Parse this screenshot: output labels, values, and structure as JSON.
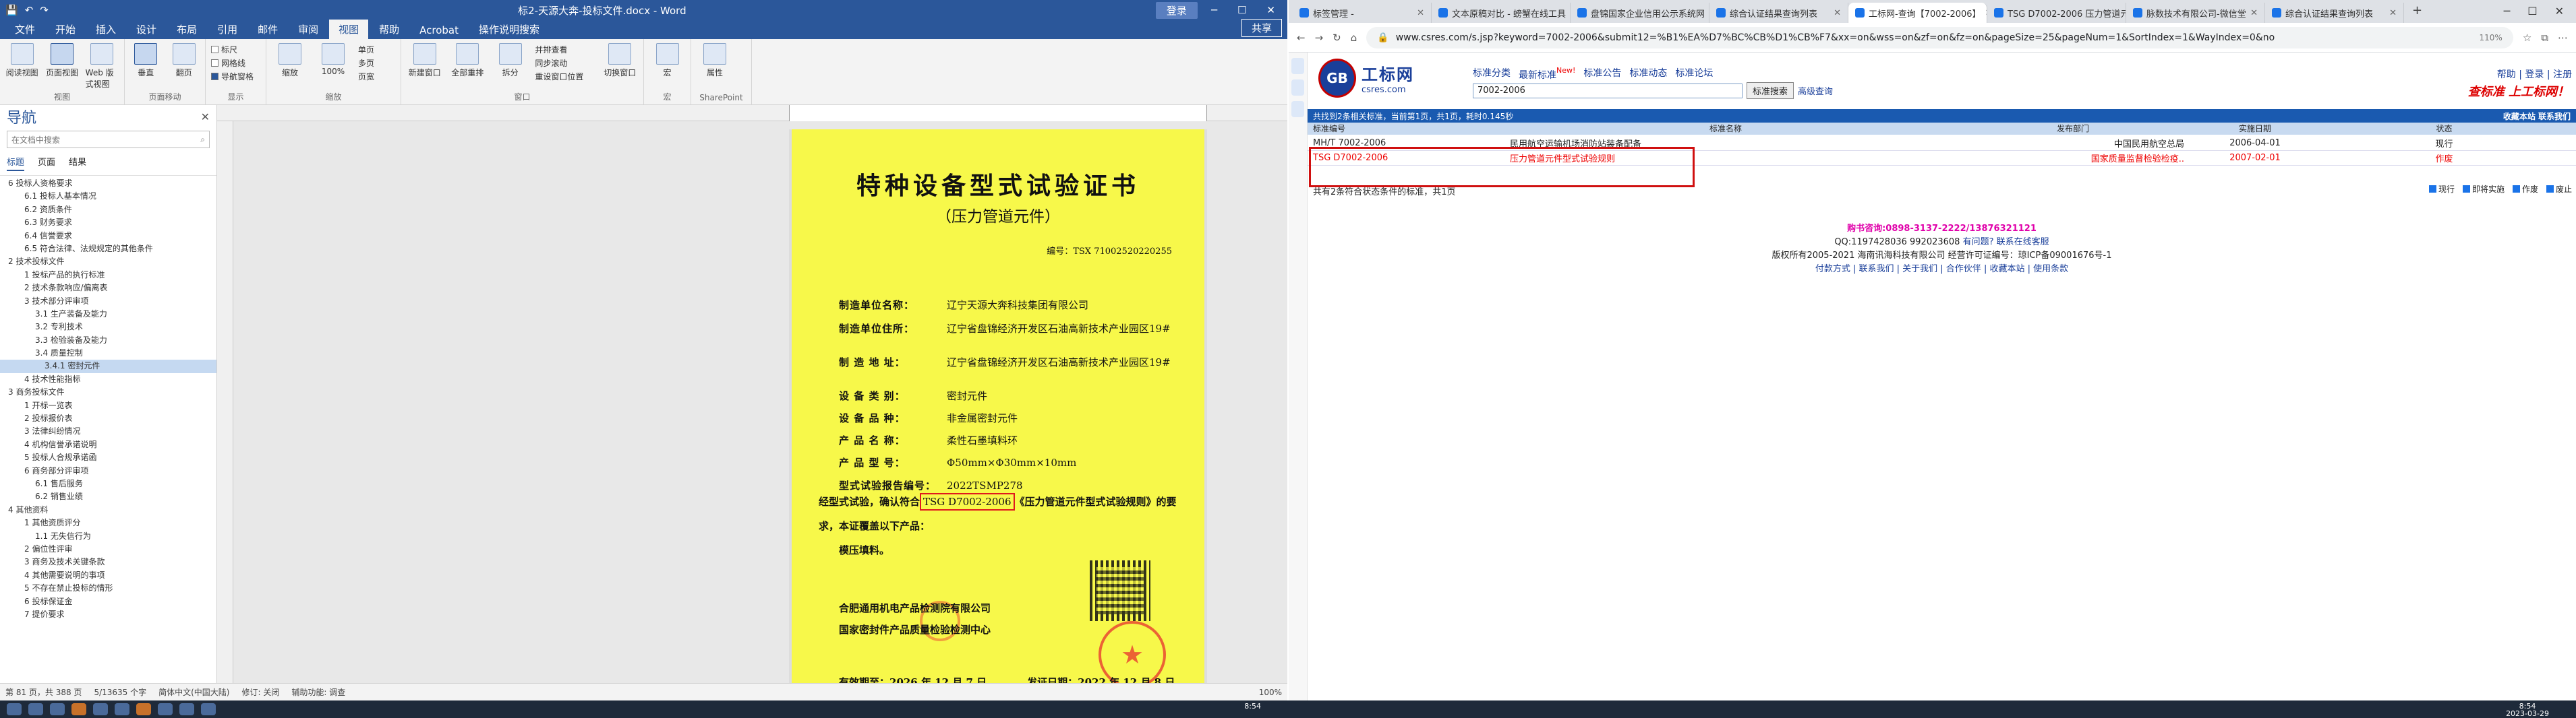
{
  "word": {
    "title": "标2-天源大奔-投标文件.docx - Word",
    "user_button": "登录",
    "share_label": "共享",
    "tabs": [
      "文件",
      "开始",
      "插入",
      "设计",
      "布局",
      "引用",
      "邮件",
      "审阅",
      "视图",
      "帮助",
      "Acrobat",
      "操作说明搜索"
    ],
    "active_tab": "视图",
    "ribbon": {
      "views": [
        "阅读视图",
        "页面视图",
        "Web 版式视图"
      ],
      "views_group": "视图",
      "move": [
        "垂直",
        "翻页"
      ],
      "move_group": "页面移动",
      "show": [
        "标尺",
        "网格线",
        "导航窗格"
      ],
      "show_group": "显示",
      "zoom": [
        "缩放",
        "100%",
        "单页",
        "多页",
        "页宽"
      ],
      "zoom_group": "缩放",
      "window": [
        "新建窗口",
        "全部重排",
        "拆分",
        "并排查看",
        "同步滚动",
        "重设窗口位置",
        "切换窗口"
      ],
      "window_group": "窗口",
      "macro": "宏",
      "macro_group": "宏",
      "sp": "属性",
      "sp_group": "SharePoint"
    },
    "nav": {
      "title": "导航",
      "search_placeholder": "在文档中搜索",
      "tabs": [
        "标题",
        "页面",
        "结果"
      ],
      "items": [
        {
          "t": "6 投标人资格要求",
          "l": "l1"
        },
        {
          "t": "6.1 投标人基本情况",
          "l": "l2"
        },
        {
          "t": "6.2 资质条件",
          "l": "l2"
        },
        {
          "t": "6.3 财务要求",
          "l": "l2"
        },
        {
          "t": "6.4 信誉要求",
          "l": "l2"
        },
        {
          "t": "6.5 符合法律、法规规定的其他条件",
          "l": "l2"
        },
        {
          "t": "2 技术投标文件",
          "l": "l1"
        },
        {
          "t": "1 投标产品的执行标准",
          "l": "l2"
        },
        {
          "t": "2 技术条款响应/偏离表",
          "l": "l2"
        },
        {
          "t": "3 技术部分评审项",
          "l": "l2"
        },
        {
          "t": "3.1 生产装备及能力",
          "l": "l3"
        },
        {
          "t": "3.2 专利技术",
          "l": "l3"
        },
        {
          "t": "3.3 检验装备及能力",
          "l": "l3"
        },
        {
          "t": "3.4 质量控制",
          "l": "l3"
        },
        {
          "t": "3.4.1 密封元件",
          "l": "l4",
          "sel": true
        },
        {
          "t": "4 技术性能指标",
          "l": "l2"
        },
        {
          "t": "3 商务投标文件",
          "l": "l1"
        },
        {
          "t": "1 开标一览表",
          "l": "l2"
        },
        {
          "t": "2 投标报价表",
          "l": "l2"
        },
        {
          "t": "3 法律纠纷情况",
          "l": "l2"
        },
        {
          "t": "4 机构信誉承诺说明",
          "l": "l2"
        },
        {
          "t": "5 投标人合规承诺函",
          "l": "l2"
        },
        {
          "t": "6 商务部分评审项",
          "l": "l2"
        },
        {
          "t": "6.1 售后服务",
          "l": "l3"
        },
        {
          "t": "6.2 销售业绩",
          "l": "l3"
        },
        {
          "t": "4 其他资料",
          "l": "l1"
        },
        {
          "t": "1 其他资质评分",
          "l": "l2"
        },
        {
          "t": "1.1 无失信行为",
          "l": "l3"
        },
        {
          "t": "2 偏位性评审",
          "l": "l2"
        },
        {
          "t": "3 商务及技术关键条款",
          "l": "l2"
        },
        {
          "t": "4 其他需要说明的事项",
          "l": "l2"
        },
        {
          "t": "5 不存在禁止投标的情形",
          "l": "l2"
        },
        {
          "t": "6 投标保证金",
          "l": "l2"
        },
        {
          "t": "7 提价要求",
          "l": "l2"
        }
      ]
    },
    "cert": {
      "title": "特种设备型式试验证书",
      "subtitle": "（压力管道元件）",
      "number_label": "编号：TSX 71002520220255",
      "rows": [
        {
          "k": "制造单位名称：",
          "v": "辽宁天源大奔科技集团有限公司"
        },
        {
          "k": "制造单位住所：",
          "v": "辽宁省盘锦经济开发区石油高新技术产业园区19#"
        },
        {
          "k": "制 造 地 址：",
          "v": "辽宁省盘锦经济开发区石油高新技术产业园区19#"
        },
        {
          "k": "设 备 类 别：",
          "v": "密封元件"
        },
        {
          "k": "设 备 品 种：",
          "v": "非金属密封元件"
        },
        {
          "k": "产 品 名 称：",
          "v": "柔性石墨填料环"
        },
        {
          "k": "产 品 型 号：",
          "v": "Φ50mm×Φ30mm×10mm"
        },
        {
          "k": "型式试验报告编号：",
          "v": "2022TSMP278"
        }
      ],
      "conf_pre": "经型式试验，确认符合",
      "conf_std": "TSG D7002-2006",
      "conf_post": "《压力管道元件型式试验规则》的要求，本证覆盖以下产品：",
      "conf_extra": "模压填料。",
      "issuer1": "合肥通用机电产品检测院有限公司",
      "issuer2": "国家密封件产品质量检验检测中心",
      "valid": "有效期至：2026 年 12 月 7 日",
      "issue": "发证日期：2022 年 12 月 8 日"
    },
    "status": {
      "page": "第 81 页，共 388 页",
      "words": "5/13635 个字",
      "lang": "简体中文(中国大陆)",
      "track": "修订: 关闭",
      "access": "辅助功能: 调查",
      "zoom": "100%"
    }
  },
  "browser": {
    "tabs": [
      {
        "t": "标签管理 -",
        "active": false
      },
      {
        "t": "文本原稿对比 - 螃蟹在线工具",
        "active": false
      },
      {
        "t": "盘锦国家企业信用公示系统网",
        "active": false
      },
      {
        "t": "综合认证结果查询列表",
        "active": false
      },
      {
        "t": "工标网-查询【7002-2006】",
        "active": true
      },
      {
        "t": "TSG D7002-2006 压力管道元件",
        "active": false
      },
      {
        "t": "脉数技术有限公司-微信堂",
        "active": false
      },
      {
        "t": "综合认证结果查询列表",
        "active": false
      }
    ],
    "url": "www.csres.com/s.jsp?keyword=7002-2006&submit12=%B1%EA%D7%BC%CB%D1%CB%F7&xx=on&wss=on&zf=on&fz=on&pageSize=25&pageNum=1&SortIndex=1&WayIndex=0&no",
    "zoom_label": "110%"
  },
  "site": {
    "logo_badge": "GB",
    "logo_name": "工标网",
    "logo_domain": "csres.com",
    "nav": [
      "标准分类",
      "最新标准",
      "标准公告",
      "标准动态",
      "标准论坛"
    ],
    "new_badge": "New!",
    "search_value": "7002-2006",
    "search_button": "标准搜索",
    "adv_search": "高级查询",
    "right_links": "帮助 | 登录 | 注册",
    "slogan": "查标准 上工标网！",
    "result_info": "共找到2条相关标准，当前第1页，共1页，耗时0.145秒",
    "result_right": "收藏本站 联系我们",
    "headers": [
      "标准编号",
      "标准名称",
      "发布部门",
      "实施日期",
      "状态"
    ],
    "rows": [
      {
        "no": "MH/T 7002-2006",
        "name": "民用航空运输机场消防站装备配备",
        "dept": "中国民用航空总局",
        "date": "2006-04-01",
        "status": "现行",
        "red": false
      },
      {
        "no": "TSG D7002-2006",
        "name": "压力管道元件型式试验规则",
        "dept": "国家质量监督检验检疫..",
        "date": "2007-02-01",
        "status": "作废",
        "red": true
      }
    ],
    "count_text": "共有2条符合状态条件的标准，共1页",
    "filters": [
      "现行",
      "即将实施",
      "作废",
      "废止"
    ],
    "footer": {
      "phone": "购书咨询:0898-3137-2222/13876321121",
      "qq": "QQ:1197428036 992023608",
      "qq_link": "有问题? 联系在线客服",
      "copyright": "版权所有2005-2021 海南讯海科技有限公司 经营许可证编号：琼ICP备09001676号-1",
      "links": "付款方式 | 联系我们 | 关于我们 | 合作伙伴 | 收藏本站 | 使用条款"
    }
  },
  "taskbar": {
    "time": "8:54",
    "date": "2023-03-29",
    "time2": "8:54"
  }
}
